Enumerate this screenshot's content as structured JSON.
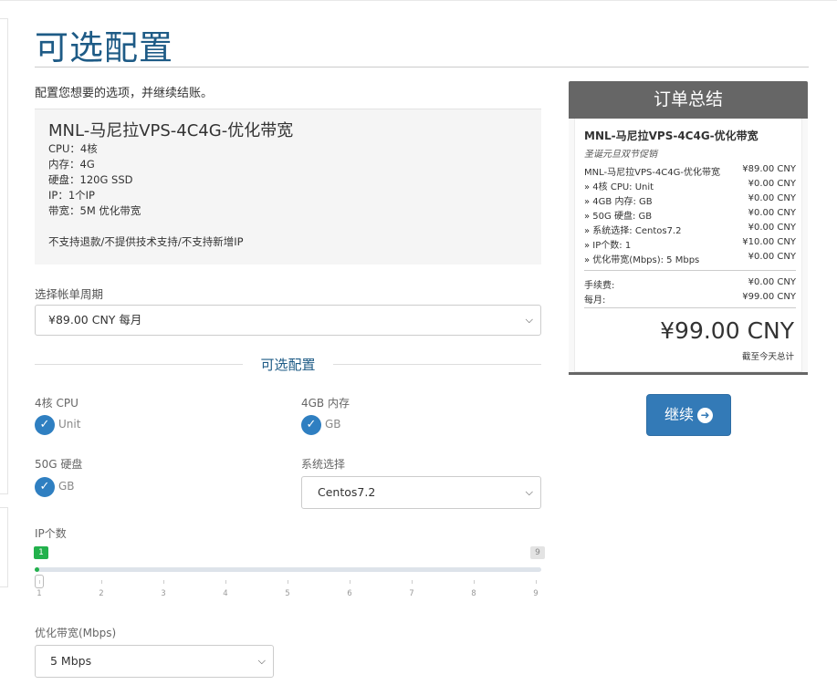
{
  "page": {
    "title": "可选配置",
    "intro": "配置您想要的选项，并继续结账。"
  },
  "product": {
    "name": "MNL-马尼拉VPS-4C4G-优化带宽",
    "specs": [
      "CPU：4核",
      "内存：4G",
      "硬盘：120G SSD",
      "IP：1个IP",
      "带宽：5M 优化带宽"
    ],
    "note": "不支持退款/不提供技术支持/不支持新增IP"
  },
  "billing": {
    "label": "选择帐单周期",
    "value": "¥89.00 CNY 每月"
  },
  "options_section": {
    "title": "可选配置",
    "cpu": {
      "label": "4核 CPU",
      "unit": "Unit"
    },
    "ram": {
      "label": "4GB 内存",
      "unit": "GB"
    },
    "disk": {
      "label": "50G 硬盘",
      "unit": "GB"
    },
    "os": {
      "label": "系统选择",
      "value": "Centos7.2"
    },
    "ip": {
      "label": "IP个数",
      "value": "1",
      "max": "9",
      "ticks": [
        "1",
        "2",
        "3",
        "4",
        "5",
        "6",
        "7",
        "8",
        "9"
      ]
    },
    "bandwidth": {
      "label": "优化带宽(Mbps)",
      "value": "5 Mbps"
    }
  },
  "summary": {
    "title": "订单总结",
    "product_name": "MNL-马尼拉VPS-4C4G-优化带宽",
    "promo": "圣诞元旦双节促销",
    "lines": [
      {
        "label": "MNL-马尼拉VPS-4C4G-优化带宽",
        "price": "¥89.00 CNY"
      },
      {
        "label": "» 4核 CPU: Unit",
        "price": "¥0.00 CNY"
      },
      {
        "label": "» 4GB 内存: GB",
        "price": "¥0.00 CNY"
      },
      {
        "label": "» 50G 硬盘: GB",
        "price": "¥0.00 CNY"
      },
      {
        "label": "» 系统选择: Centos7.2",
        "price": "¥0.00 CNY"
      },
      {
        "label": "» IP个数: 1",
        "price": "¥10.00 CNY"
      },
      {
        "label": "» 优化带宽(Mbps): 5 Mbps",
        "price": "¥0.00 CNY"
      }
    ],
    "fees": [
      {
        "label": "手续费:",
        "price": "¥0.00 CNY"
      },
      {
        "label": "每月:",
        "price": "¥99.00 CNY"
      }
    ],
    "total": "¥99.00 CNY",
    "total_note": "截至今天总计"
  },
  "continue_button": {
    "label": "继续"
  },
  "colors": {
    "accent": "#1e5b86",
    "button": "#337ab7",
    "check": "#2f7fc1",
    "slider_fill": "#22b14c"
  }
}
